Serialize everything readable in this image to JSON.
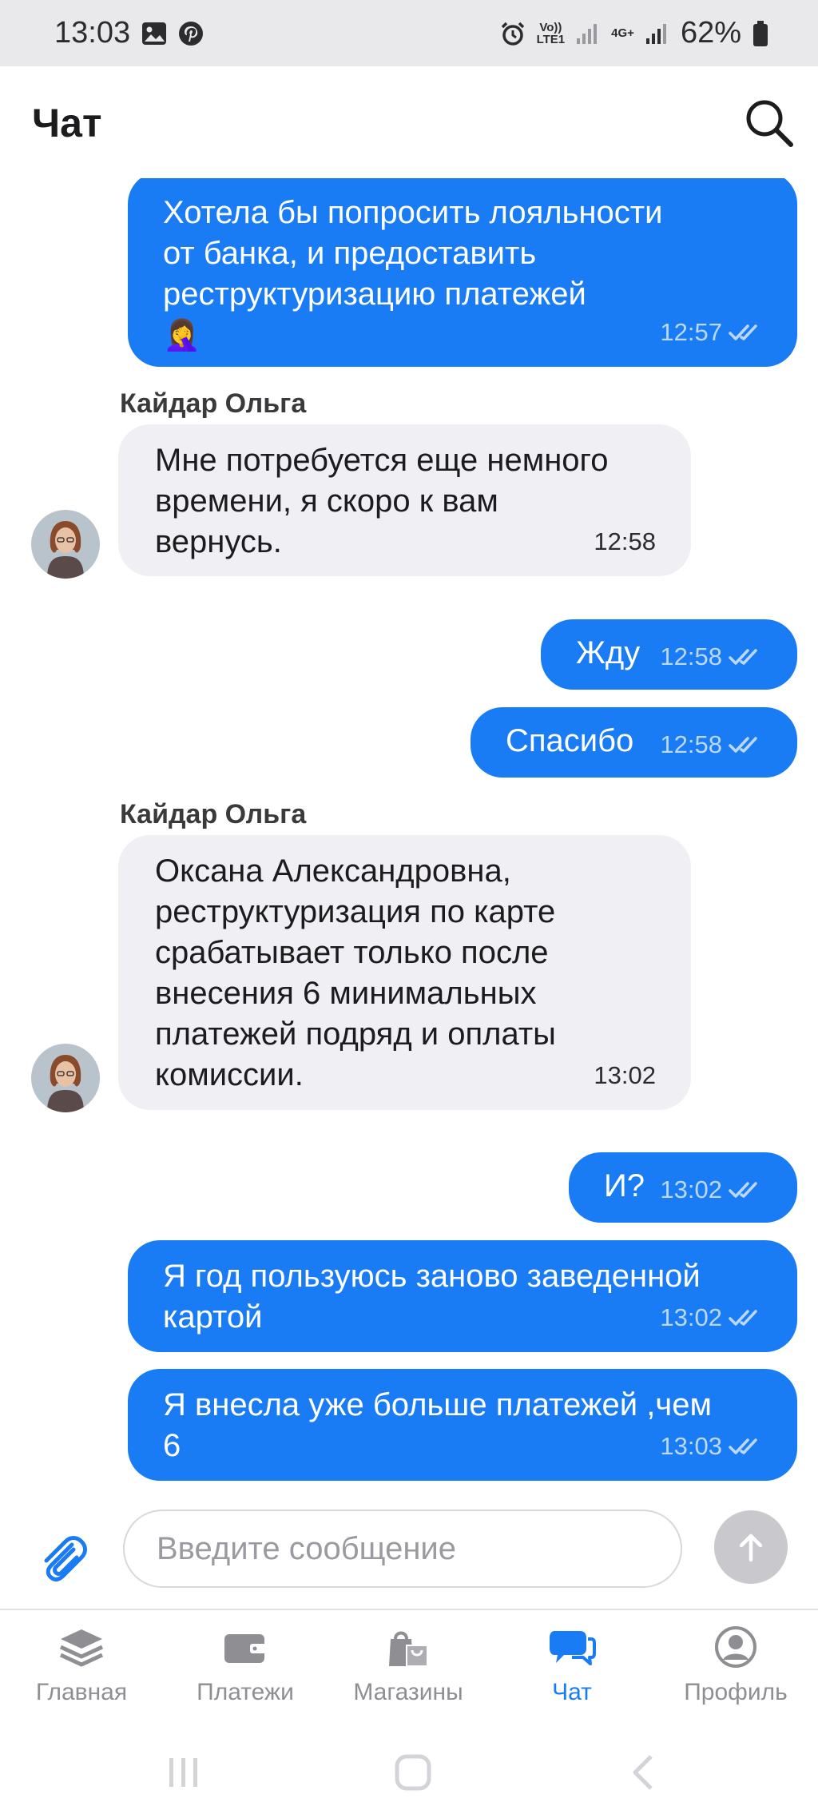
{
  "status_bar": {
    "time": "13:03",
    "left_icons": [
      "gallery-icon",
      "pinterest-icon"
    ],
    "volte_top": "Vo))",
    "volte_bottom": "LTE1",
    "network": "4G+",
    "battery": "62%"
  },
  "header": {
    "title": "Чат"
  },
  "messages": [
    {
      "direction": "out",
      "text": "Хотела бы попросить лояльности\nот банка, и предоставить\nреструктуризацию платежей",
      "emoji": "🤦‍♀️",
      "time": "12:57",
      "read": true
    },
    {
      "direction": "in",
      "sender": "Кайдар Ольга",
      "text": "Мне потребуется еще немного\nвремени, я скоро к вам\nвернусь.",
      "time": "12:58"
    },
    {
      "direction": "out",
      "text": "Жду",
      "time": "12:58",
      "read": true
    },
    {
      "direction": "out",
      "text": "Спасибо",
      "time": "12:58",
      "read": true
    },
    {
      "direction": "in",
      "sender": "Кайдар Ольга",
      "text": "Оксана Александровна,\nреструктуризация по карте\nсрабатывает только после\nвнесения 6 минимальных\nплатежей подряд и оплаты\nкомиссии.",
      "time": "13:02"
    },
    {
      "direction": "out",
      "text": "И?",
      "time": "13:02",
      "read": true
    },
    {
      "direction": "out",
      "text": "Я год пользуюсь заново заведенной\nкартой",
      "time": "13:02",
      "read": true
    },
    {
      "direction": "out",
      "text": "Я внесла уже больше платежей ,чем\n6",
      "time": "13:03",
      "read": true
    }
  ],
  "composer": {
    "placeholder": "Введите сообщение",
    "value": ""
  },
  "nav": {
    "items": [
      {
        "label": "Главная",
        "icon": "layers-icon",
        "active": false
      },
      {
        "label": "Платежи",
        "icon": "wallet-icon",
        "active": false
      },
      {
        "label": "Магазины",
        "icon": "shopping-bags-icon",
        "active": false
      },
      {
        "label": "Чат",
        "icon": "chat-bubbles-icon",
        "active": true
      },
      {
        "label": "Профиль",
        "icon": "profile-icon",
        "active": false
      }
    ]
  },
  "colors": {
    "accent": "#1a7cf4",
    "incoming_bubble": "#efeff4",
    "status_bar": "#e9e9eb"
  }
}
